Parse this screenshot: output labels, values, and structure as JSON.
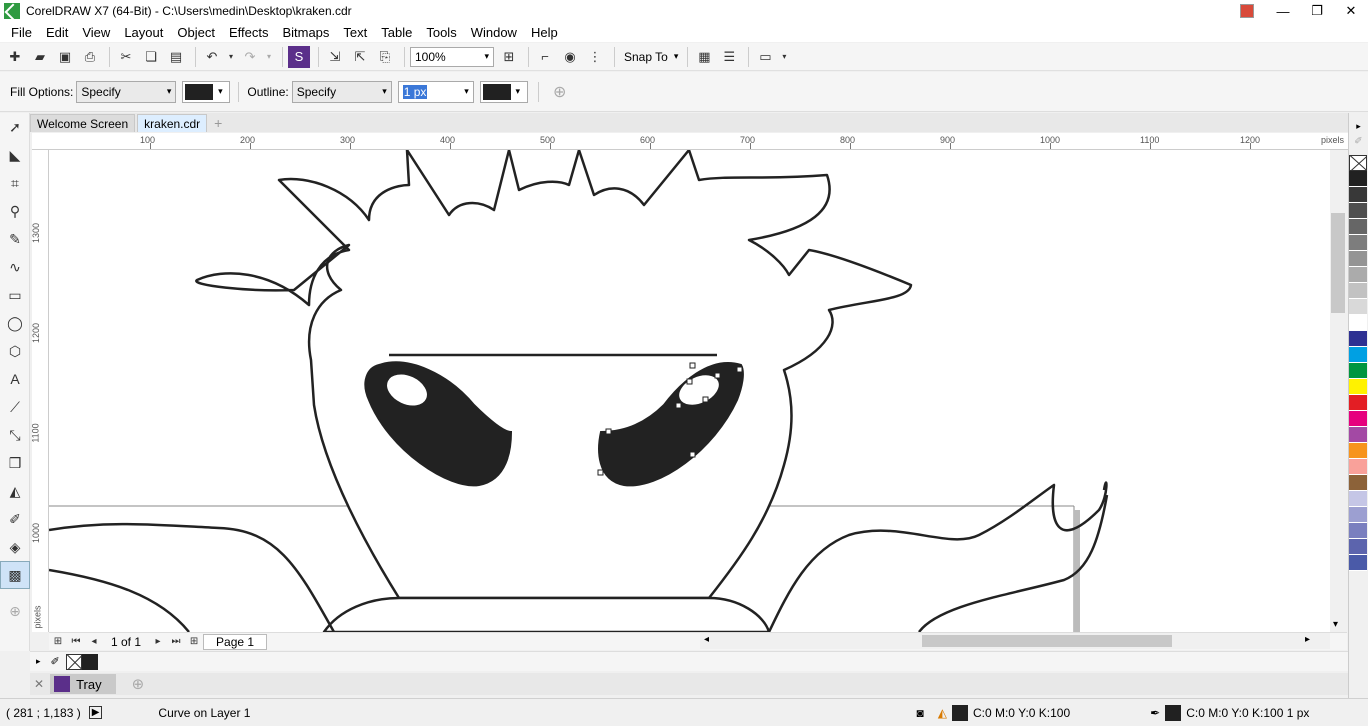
{
  "window": {
    "title": "CorelDRAW X7 (64-Bit) - C:\\Users\\medin\\Desktop\\kraken.cdr",
    "minimize": "—",
    "restore": "❐",
    "close": "✕"
  },
  "menu": [
    "File",
    "Edit",
    "View",
    "Layout",
    "Object",
    "Effects",
    "Bitmaps",
    "Text",
    "Table",
    "Tools",
    "Window",
    "Help"
  ],
  "toolbar": {
    "zoom_value": "100%",
    "snap_label": "Snap To"
  },
  "property_bar": {
    "fill_label": "Fill Options:",
    "fill_value": "Specify",
    "outline_label": "Outline:",
    "outline_value": "Specify",
    "outline_width": "1 px",
    "fill_color": "#212121",
    "outline_color": "#212121"
  },
  "tabs": [
    {
      "label": "Welcome Screen",
      "active": false
    },
    {
      "label": "kraken.cdr",
      "active": true
    }
  ],
  "ruler": {
    "unit": "pixels",
    "h_labels": [
      "100",
      "200",
      "300",
      "400",
      "500",
      "600",
      "700",
      "800",
      "900",
      "1000",
      "1100",
      "1200"
    ],
    "v_labels": [
      "1300",
      "1200",
      "1100",
      "1000"
    ],
    "v_unit": "pixels"
  },
  "page_nav": {
    "count": "1 of 1",
    "page_tab": "Page 1"
  },
  "tray": {
    "label": "Tray"
  },
  "status": {
    "coords": "( 281  ; 1,183 )",
    "object_info": "Curve on Layer 1",
    "fill_info": "C:0 M:0 Y:0 K:100",
    "outline_info": "C:0 M:0 Y:0 K:100  1 px"
  },
  "palette_colors": [
    "#212121",
    "#383838",
    "#4f4f4f",
    "#666666",
    "#7d7d7d",
    "#949494",
    "#ababab",
    "#c2c2c2",
    "#d9d9d9",
    "#ffffff",
    "#2e3192",
    "#00a0e3",
    "#009640",
    "#fff200",
    "#e31e24",
    "#e6007e",
    "#a349a4",
    "#f7941d",
    "#f9a19a",
    "#8c6239",
    "#c5c6e6",
    "#9c9fd1",
    "#7a7fbf",
    "#5c64ad",
    "#4a5aa8"
  ]
}
